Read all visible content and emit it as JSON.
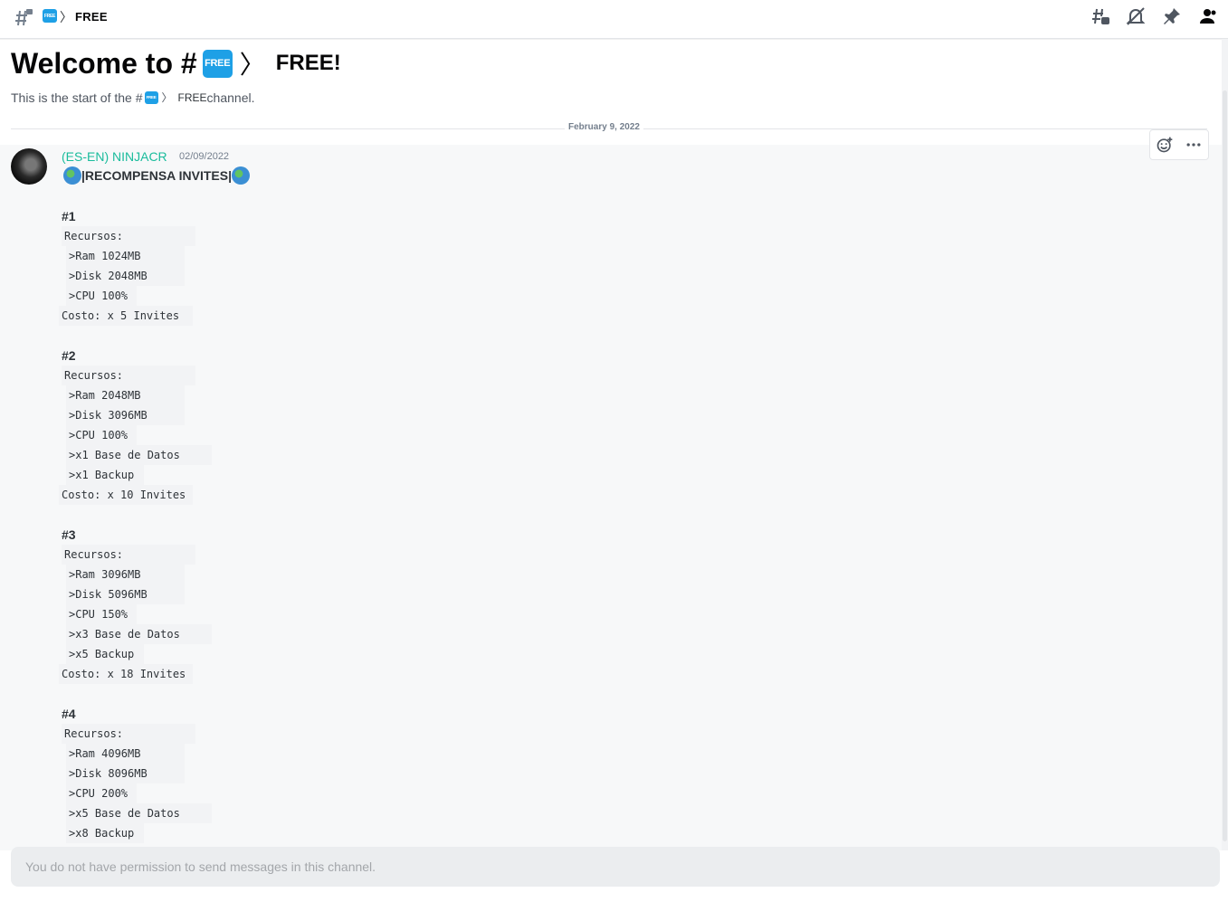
{
  "header": {
    "channel_name": "FREE",
    "emoji_label": "FREE",
    "chevron": "〉",
    "icons": [
      "threads-icon",
      "bell-muted-icon",
      "pin-icon",
      "member-list-icon"
    ]
  },
  "welcome": {
    "title_prefix": "Welcome to #",
    "channel_name": "FREE!",
    "emoji_label": "FREE",
    "chevron": "〉",
    "subtitle_prefix": "This is the start of the #",
    "subtitle_channel": "FREE",
    "subtitle_suffix": " channel."
  },
  "divider": {
    "date": "February 9, 2022"
  },
  "message": {
    "author": "(ES-EN) NINJACR",
    "timestamp": "02/09/2022",
    "title": "|RECOMPENSA INVITES|",
    "tiers": [
      {
        "heading": "#1",
        "lines": [
          "Recursos:",
          ">Ram 1024MB",
          ">Disk 2048MB",
          ">CPU 100%",
          "Costo: x 5 Invites"
        ]
      },
      {
        "heading": "#2",
        "lines": [
          "Recursos:",
          ">Ram 2048MB",
          ">Disk 3096MB",
          ">CPU 100%",
          ">x1 Base de Datos",
          ">x1 Backup",
          "Costo: x 10 Invites"
        ]
      },
      {
        "heading": "#3",
        "lines": [
          "Recursos:",
          ">Ram 3096MB",
          ">Disk 5096MB",
          ">CPU 150%",
          ">x3 Base de Datos",
          ">x5 Backup",
          "Costo: x 18 Invites"
        ]
      },
      {
        "heading": "#4",
        "lines": [
          "Recursos:",
          ">Ram 4096MB",
          ">Disk 8096MB",
          ">CPU 200%",
          ">x5 Base de Datos",
          ">x8 Backup"
        ]
      }
    ]
  },
  "composer": {
    "placeholder": "You do not have permission to send messages in this channel."
  },
  "colors": {
    "author": "#1abc9c",
    "emoji_bg": "#1ea0e6",
    "text": "#2e3338"
  }
}
